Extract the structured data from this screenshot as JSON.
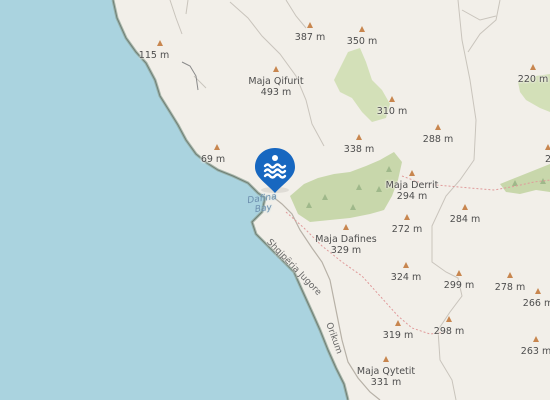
{
  "map": {
    "colors": {
      "sea": "#aad3df",
      "land": "#f2efe9",
      "coast": "#7a8c80",
      "wood": "#c8d7ab",
      "scrub": "#d3e0b8",
      "peak": "#c8864f",
      "marker": "#1767c0",
      "path": "#e09a9a"
    },
    "water": {
      "bay": "Dafina\nBay"
    },
    "roads": {
      "coastal": "Shqipëria Jugore",
      "south": "Orikum"
    },
    "peaks": [
      {
        "name": "",
        "elev": "387 m"
      },
      {
        "name": "",
        "elev": "350 m"
      },
      {
        "name": "",
        "elev": "115 m"
      },
      {
        "name": "Maja Qifurit",
        "elev": "493 m"
      },
      {
        "name": "",
        "elev": "310 m"
      },
      {
        "name": "",
        "elev": "220 m"
      },
      {
        "name": "",
        "elev": "338 m"
      },
      {
        "name": "",
        "elev": "288 m"
      },
      {
        "name": "",
        "elev": "69 m"
      },
      {
        "name": "Maja Derrit",
        "elev": "294 m"
      },
      {
        "name": "",
        "elev": "284 m"
      },
      {
        "name": "",
        "elev": "272 m"
      },
      {
        "name": "Maja Dafines",
        "elev": "329 m"
      },
      {
        "name": "",
        "elev": "324 m"
      },
      {
        "name": "",
        "elev": "299 m"
      },
      {
        "name": "",
        "elev": "278 m"
      },
      {
        "name": "",
        "elev": "266 m"
      },
      {
        "name": "",
        "elev": "298 m"
      },
      {
        "name": "",
        "elev": "319 m"
      },
      {
        "name": "",
        "elev": "263 m"
      },
      {
        "name": "Maja Qytetit",
        "elev": "331 m"
      },
      {
        "name": "",
        "elev": "2"
      }
    ],
    "poi": {
      "icon": "swimming-icon"
    }
  }
}
